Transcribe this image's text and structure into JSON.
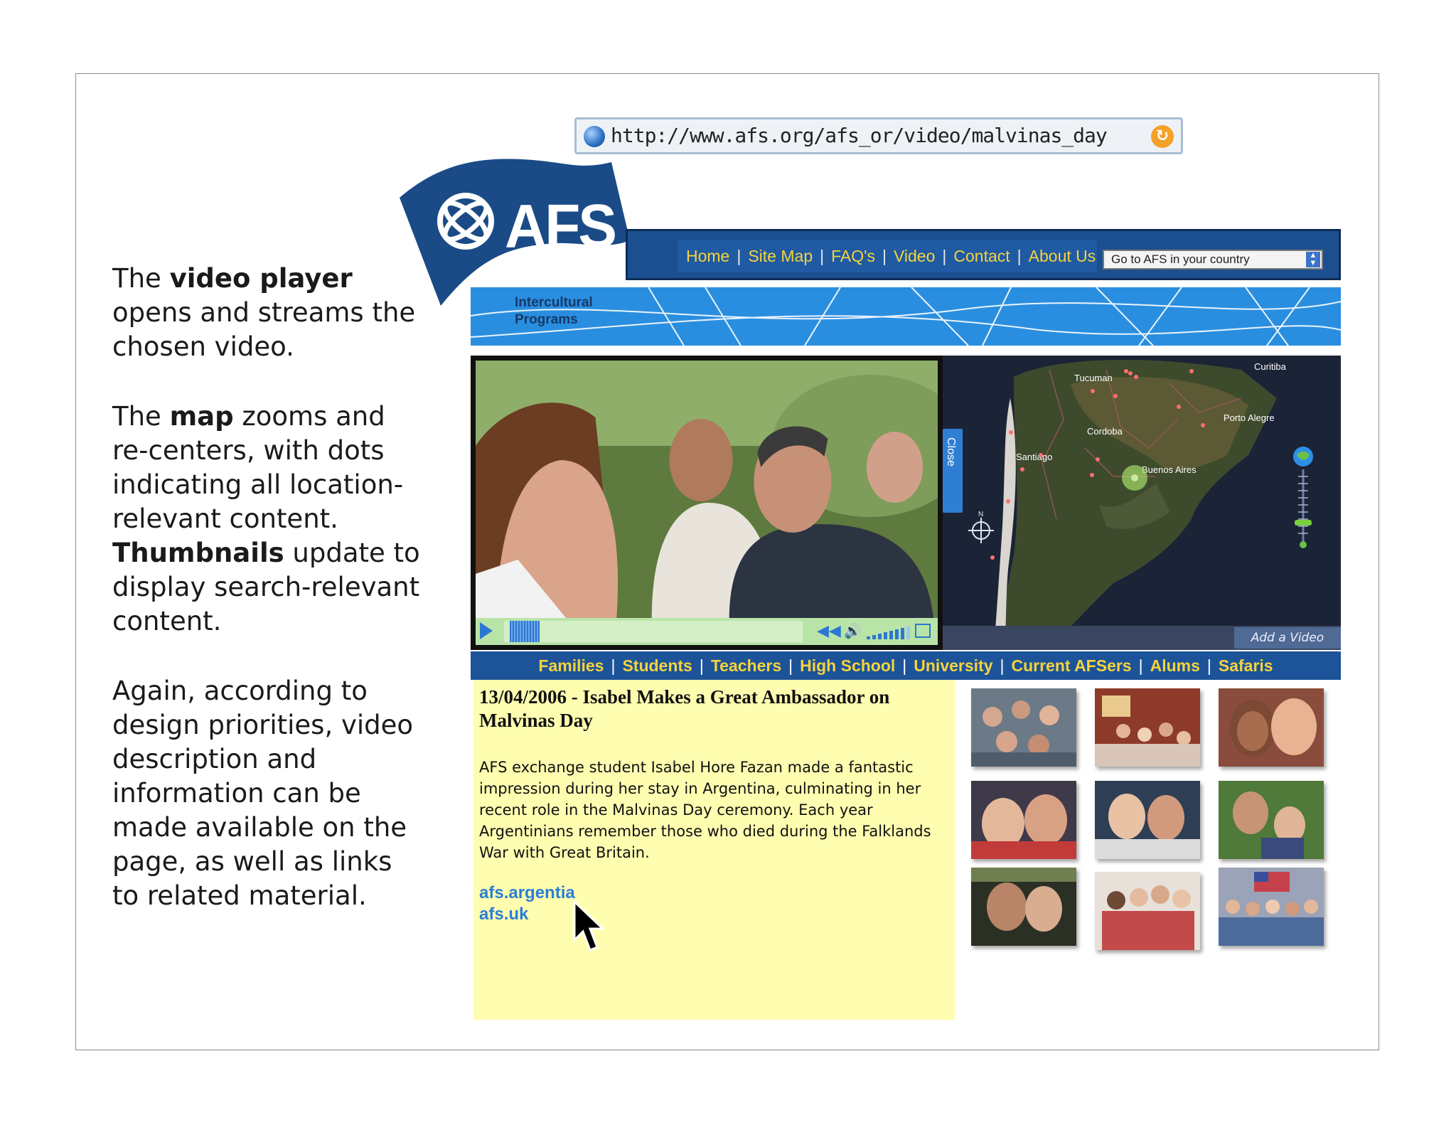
{
  "captions": {
    "p1": [
      "The ",
      "video player",
      " opens and streams the chosen video."
    ],
    "p2": [
      "The ",
      "map",
      " zooms and re-centers, with dots indicating all location-relevant content. ",
      "Thumbnails",
      " update to display search-relevant content."
    ],
    "p3": "Again, according to design priorities, video description and information can be made available on the page, as well as links to related material."
  },
  "browser": {
    "url": "http://www.afs.org/afs_or/video/malvinas_day"
  },
  "logo": {
    "name": "AFS",
    "tagline_line1": "Intercultural",
    "tagline_line2": "Programs"
  },
  "top_nav": {
    "items": [
      "Home",
      "Site Map",
      "FAQ's",
      "Video",
      "Contact",
      "About Us"
    ],
    "country_select": "Go to AFS in your country"
  },
  "map": {
    "close_label": "Close",
    "add_video_label": "Add a Video",
    "places": [
      "Curitiba",
      "Tucuman",
      "Porto Alegre",
      "Cordoba",
      "Santiago",
      "Buenos Aires"
    ],
    "compass": "N",
    "zoom_level": 0.35
  },
  "category_nav": [
    "Families",
    "Students",
    "Teachers",
    "High School",
    "University",
    "Current AFSers",
    "Alums",
    "Safaris"
  ],
  "description": {
    "title": "13/04/2006 - Isabel Makes a Great Ambassador on Malvinas Day",
    "body": "AFS exchange student Isabel Hore Fazan made a fantastic impression during her stay in Argentina, culminating in her recent role in the Malvinas Day ceremony. Each year Argentinians remember those who died during the Falklands War with Great Britain.",
    "links": [
      "afs.argentia",
      "afs.uk"
    ]
  },
  "video": {
    "progress": 0.1,
    "volume": 0.8
  },
  "colors": {
    "nav_blue": "#1b4f8f",
    "nav_link": "#f5d33c",
    "desc_bg": "#fffdb0",
    "link_blue": "#2a7fd6"
  }
}
